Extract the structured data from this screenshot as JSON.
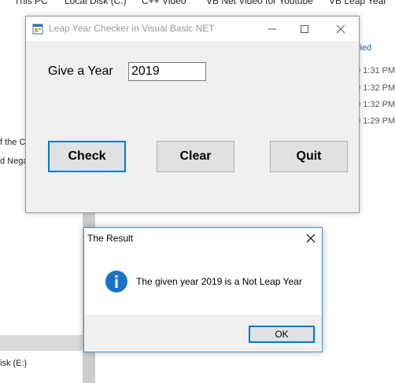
{
  "background": {
    "breadcrumb": [
      "This PC",
      "Local Disk (C:)",
      "C++ Video",
      "VB Net Video for Youtube",
      "VB Leap Year"
    ],
    "modified_header": "ified",
    "times": [
      "9 1:31 PM",
      "9 1:32 PM",
      "9 1:32 PM",
      "9 1:29 PM"
    ],
    "left_fragments": [
      "f the C",
      "d Nega"
    ],
    "drive_label": "isk (E:)"
  },
  "main_window": {
    "title": "Leap Year Checker in Visual Basic NET",
    "year_label": "Give a Year",
    "year_value": "2019",
    "buttons": {
      "check": "Check",
      "clear": "Clear",
      "quit": "Quit"
    }
  },
  "message_box": {
    "title": "The Result",
    "text": "The given year 2019 is a Not Leap Year",
    "ok_label": "OK"
  }
}
